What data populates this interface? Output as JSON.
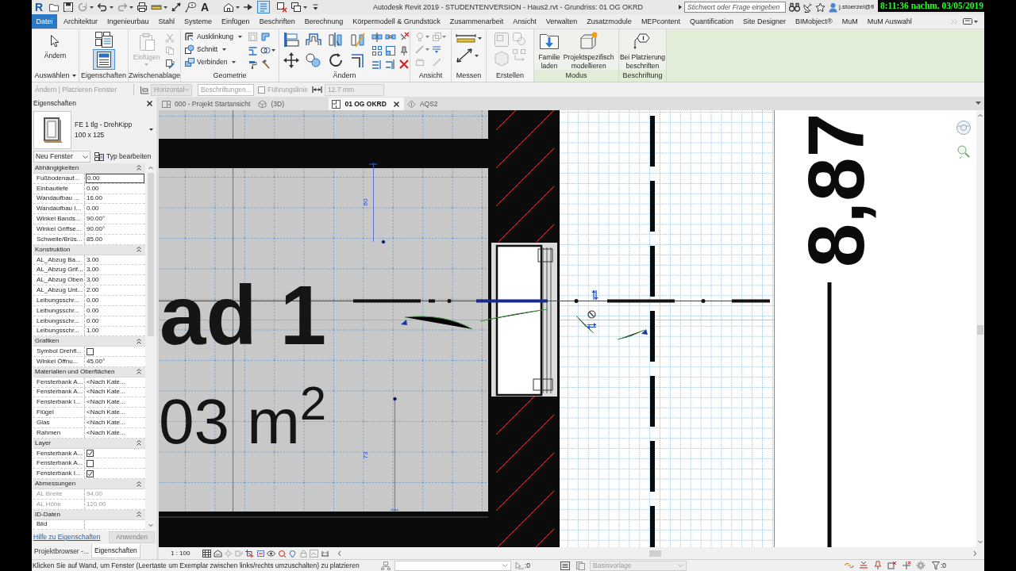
{
  "window": {
    "title": "Autodesk Revit 2019 - STUDENTENVERSION - Haus2.rvt - Grundriss: 01 OG OKRD",
    "logo": "R"
  },
  "quick_access": {
    "text_tool": "A",
    "thin_lines_on": true
  },
  "search": {
    "placeholder": "Stichwort oder Frage eingeben"
  },
  "user": {
    "name": "j.stoerzel@fl"
  },
  "clock_overlay": "8:11:36 nachm. 03/05/2019",
  "menu_tabs": [
    {
      "label": "Datei",
      "kind": "file"
    },
    {
      "label": "Architektur",
      "kind": "tab"
    },
    {
      "label": "Ingenieurbau",
      "kind": "tab"
    },
    {
      "label": "Stahl",
      "kind": "tab"
    },
    {
      "label": "Systeme",
      "kind": "tab"
    },
    {
      "label": "Einfügen",
      "kind": "tab"
    },
    {
      "label": "Beschriften",
      "kind": "tab"
    },
    {
      "label": "Berechnung",
      "kind": "tab"
    },
    {
      "label": "Körpermodell & Grundstück",
      "kind": "tab"
    },
    {
      "label": "Zusammenarbeit",
      "kind": "tab"
    },
    {
      "label": "Ansicht",
      "kind": "tab"
    },
    {
      "label": "Verwalten",
      "kind": "tab"
    },
    {
      "label": "Zusatzmodule",
      "kind": "tab"
    },
    {
      "label": "MEPcontent",
      "kind": "tab"
    },
    {
      "label": "Quantification",
      "kind": "tab"
    },
    {
      "label": "Site Designer",
      "kind": "tab"
    },
    {
      "label": "BIMobject®",
      "kind": "tab"
    },
    {
      "label": "MuM",
      "kind": "tab"
    },
    {
      "label": "MuM Auswahl",
      "kind": "tab"
    }
  ],
  "ribbon_panels": [
    {
      "kind": "select",
      "label": "Auswählen",
      "buttons": [
        {
          "label": "Ändern"
        }
      ]
    },
    {
      "kind": "properties",
      "label": "Eigenschaften",
      "buttons": [
        {
          "selected": false
        },
        {
          "selected": true
        }
      ]
    },
    {
      "kind": "clipboard",
      "label": "Zwischenablage",
      "buttons": [
        {
          "label": "Einfügen",
          "disabled": true
        }
      ]
    },
    {
      "kind": "geometry",
      "label": "Geometrie",
      "buttons": [
        {
          "label": "Ausklinkung"
        },
        {
          "label": "Schnitt"
        },
        {
          "label": "Verbinden"
        }
      ]
    },
    {
      "kind": "modify",
      "label": "Ändern"
    },
    {
      "kind": "view",
      "label": "Ansicht"
    },
    {
      "kind": "measure",
      "label": "Messen"
    },
    {
      "kind": "create",
      "label": "Erstellen"
    },
    {
      "kind": "mode",
      "label": "Modus",
      "buttons": [
        {
          "label": "Familie\nladen"
        },
        {
          "label": "Projektspezifisch\nmodellieren"
        }
      ]
    },
    {
      "kind": "tag",
      "label": "Beschriftung",
      "buttons": [
        {
          "label": "Bei Platzierung\nbeschriften"
        }
      ]
    }
  ],
  "options_bar": {
    "context": "Ändern | Platzieren Fenster",
    "orientation": "Horizontal",
    "tag_button": "Beschriftungen...",
    "leader": {
      "label": "Führungslinie",
      "checked": false
    },
    "leader_length": "12.7 mm",
    "disabled": true
  },
  "properties": {
    "title": "Eigenschaften",
    "type": {
      "name": "FE 1 tlg - DrehKipp",
      "size": "100 x 125"
    },
    "filter": "Neu Fenster",
    "edit_type": "Typ bearbeiten",
    "groups": [
      {
        "name": "Abhängigkeiten",
        "expanded": true,
        "rows": [
          {
            "label": "Fußbodenauf...",
            "value": "0.00",
            "kind": "text",
            "selected": true,
            "disabled": false
          },
          {
            "label": "Einbautiefe",
            "value": "0.00",
            "kind": "text",
            "selected": false,
            "disabled": false
          },
          {
            "label": "Wandaufbau ...",
            "value": "16.00",
            "kind": "text",
            "selected": false,
            "disabled": false
          },
          {
            "label": "Wandaufbau I...",
            "value": "0.00",
            "kind": "text",
            "selected": false,
            "disabled": false
          },
          {
            "label": "Winkel Bands...",
            "value": "90.00°",
            "kind": "text",
            "selected": false,
            "disabled": false
          },
          {
            "label": "Winkel Griffse...",
            "value": "90.00°",
            "kind": "text",
            "selected": false,
            "disabled": false
          },
          {
            "label": "Schwelle/Brüs...",
            "value": "85.00",
            "kind": "text",
            "selected": false,
            "disabled": false
          }
        ]
      },
      {
        "name": "Konstruktion",
        "expanded": true,
        "rows": [
          {
            "label": "AL_Abzug Ba...",
            "value": "3.00",
            "kind": "text",
            "selected": false,
            "disabled": false
          },
          {
            "label": "AL_Abzug Grif...",
            "value": "3.00",
            "kind": "text",
            "selected": false,
            "disabled": false
          },
          {
            "label": "AL_Abzug Oben",
            "value": "3.00",
            "kind": "text",
            "selected": false,
            "disabled": false
          },
          {
            "label": "AL_Abzug Unt...",
            "value": "2.00",
            "kind": "text",
            "selected": false,
            "disabled": false
          },
          {
            "label": "Leibungsschr...",
            "value": "0.00",
            "kind": "text",
            "selected": false,
            "disabled": false
          },
          {
            "label": "Leibungsschr...",
            "value": "0.00",
            "kind": "text",
            "selected": false,
            "disabled": false
          },
          {
            "label": "Leibungsschr...",
            "value": "0.00",
            "kind": "text",
            "selected": false,
            "disabled": false
          },
          {
            "label": "Leibungsschr...",
            "value": "1.00",
            "kind": "text",
            "selected": false,
            "disabled": false
          }
        ]
      },
      {
        "name": "Grafiken",
        "expanded": true,
        "rows": [
          {
            "label": "Symbol Drehfl...",
            "checked": false,
            "kind": "checkbox",
            "selected": false,
            "disabled": false
          },
          {
            "label": "Winkel Öffnu...",
            "value": "45.00°",
            "kind": "text",
            "selected": false,
            "disabled": false
          }
        ]
      },
      {
        "name": "Materialien und Oberflächen",
        "expanded": true,
        "rows": [
          {
            "label": "Fensterbank A...",
            "value": "<Nach Kate...",
            "kind": "text",
            "selected": false,
            "disabled": false
          },
          {
            "label": "Fensterbank A...",
            "value": "<Nach Kate...",
            "kind": "text",
            "selected": false,
            "disabled": false
          },
          {
            "label": "Fensterbank I...",
            "value": "<Nach Kate...",
            "kind": "text",
            "selected": false,
            "disabled": false
          },
          {
            "label": "Flügel",
            "value": "<Nach Kate...",
            "kind": "text",
            "selected": false,
            "disabled": false
          },
          {
            "label": "Glas",
            "value": "<Nach Kate...",
            "kind": "text",
            "selected": false,
            "disabled": false
          },
          {
            "label": "Rahmen",
            "value": "<Nach Kate...",
            "kind": "text",
            "selected": false,
            "disabled": false
          }
        ]
      },
      {
        "name": "Layer",
        "expanded": true,
        "rows": [
          {
            "label": "Fensterbank A...",
            "checked": true,
            "kind": "checkbox",
            "selected": false,
            "disabled": false
          },
          {
            "label": "Fensterbank A...",
            "checked": false,
            "kind": "checkbox",
            "selected": false,
            "disabled": false
          },
          {
            "label": "Fensterbank I...",
            "checked": true,
            "kind": "checkbox",
            "selected": false,
            "disabled": false
          }
        ]
      },
      {
        "name": "Abmessungen",
        "expanded": true,
        "rows": [
          {
            "label": "AL Breite",
            "value": "94.00",
            "kind": "text",
            "selected": false,
            "disabled": true
          },
          {
            "label": "AL Höhe",
            "value": "120.00",
            "kind": "text",
            "selected": false,
            "disabled": true
          }
        ]
      },
      {
        "name": "ID-Daten",
        "expanded": true,
        "rows": [
          {
            "label": "Bild",
            "kind": "text",
            "selected": false,
            "disabled": false
          }
        ]
      }
    ],
    "help_link": "Hilfe zu Eigenschaften",
    "apply": {
      "label": "Anwenden",
      "disabled": true
    }
  },
  "panel_tabs": [
    {
      "label": "Projektbrowser -...",
      "selected": false
    },
    {
      "label": "Eigenschaften",
      "selected": true
    }
  ],
  "view_tabs": [
    {
      "label": "000 - Projekt Startansicht",
      "kind": "sheet",
      "selected": false
    },
    {
      "label": "(3D)",
      "kind": "model",
      "selected": false
    },
    {
      "label": "01 OG OKRD",
      "kind": "plan",
      "selected": true
    },
    {
      "label": "AQS2",
      "kind": "section",
      "selected": false
    }
  ],
  "canvas": {
    "room_name": "ad 1",
    "room_area": "03 m$^{2}$",
    "dimension": "8,87",
    "temp_dimensions": [
      "60",
      "73"
    ]
  },
  "view_control": {
    "scale": "1 : 100"
  },
  "status_bar": {
    "message": "Klicken Sie auf Wand, um Fenster (Leertaste um Exemplar zwischen links/rechts umzuschalten) zu platzieren",
    "selection_count": ":0",
    "view_template": "Basisvorlage",
    "filter_count": ":0"
  }
}
